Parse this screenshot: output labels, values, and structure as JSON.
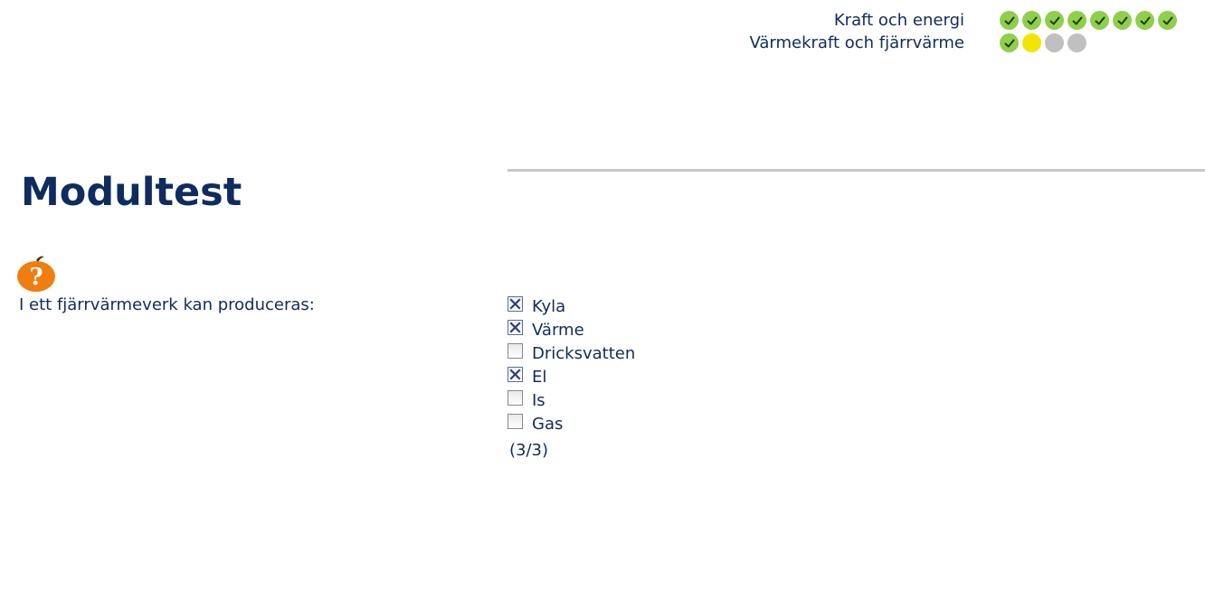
{
  "progress": {
    "rows": [
      {
        "label": "Kraft och energi",
        "dots": [
          "done",
          "done",
          "done",
          "done",
          "done",
          "done",
          "done",
          "done"
        ]
      },
      {
        "label": "Värmekraft och fjärrvärme",
        "dots": [
          "done",
          "current",
          "pending",
          "pending"
        ]
      }
    ],
    "colors": {
      "done": "#8fcf4a",
      "current": "#f2e600",
      "pending": "#c0c0c0"
    }
  },
  "test": {
    "title": "Modultest",
    "question_icon": "orange-question-icon",
    "question": "I ett fjärrvärmeverk kan produceras:",
    "options": [
      {
        "label": "Kyla",
        "checked": true
      },
      {
        "label": "Värme",
        "checked": true
      },
      {
        "label": "Dricksvatten",
        "checked": false
      },
      {
        "label": "El",
        "checked": true
      },
      {
        "label": "Is",
        "checked": false
      },
      {
        "label": "Gas",
        "checked": false
      }
    ],
    "score": "(3/3)"
  }
}
